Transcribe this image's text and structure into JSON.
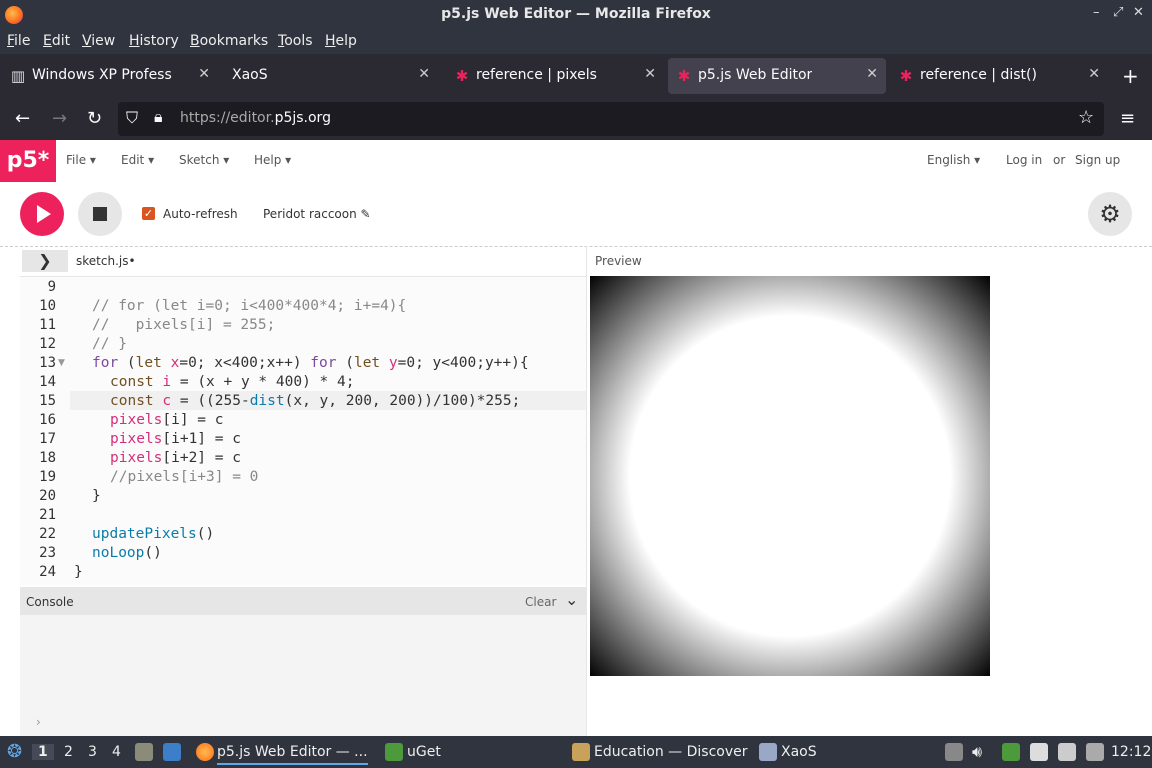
{
  "window": {
    "title": "p5.js Web Editor — Mozilla Firefox"
  },
  "menubar": [
    "File",
    "Edit",
    "View",
    "History",
    "Bookmarks",
    "Tools",
    "Help"
  ],
  "tabs": [
    {
      "label": "Windows XP Professional",
      "icon": "windows-icon"
    },
    {
      "label": "XaoS",
      "icon": "none"
    },
    {
      "label": "reference | pixels",
      "icon": "p5-star-icon"
    },
    {
      "label": "p5.js Web Editor",
      "icon": "p5-star-icon",
      "active": true
    },
    {
      "label": "reference | dist()",
      "icon": "p5-star-icon"
    }
  ],
  "url": {
    "prefix": "https://editor.",
    "domain": "p5js.org"
  },
  "p5": {
    "logo": "p5*",
    "menu": [
      "File",
      "Edit",
      "Sketch",
      "Help"
    ],
    "language": "English",
    "login": "Log in",
    "or": "or",
    "signup": "Sign up",
    "auto_refresh": "Auto-refresh",
    "sketch_name": "Peridot raccoon",
    "file_tab": "sketch.js",
    "preview_label": "Preview",
    "console_label": "Console",
    "clear_label": "Clear"
  },
  "code": {
    "line_numbers": [
      "9",
      "10",
      "11",
      "12",
      "13",
      "14",
      "15",
      "16",
      "17",
      "18",
      "19",
      "20",
      "21",
      "22",
      "23",
      "24"
    ],
    "current_line": "15"
  },
  "taskbar": {
    "workspaces": [
      "1",
      "2",
      "3",
      "4"
    ],
    "apps": [
      "p5.js Web Editor — ...",
      "uGet",
      "Education — Discover",
      "XaoS"
    ],
    "clock": "12:12"
  },
  "colors": {
    "accent": "#ed225d",
    "chrome": "#2b2a33",
    "checkbox": "#d9541e"
  }
}
